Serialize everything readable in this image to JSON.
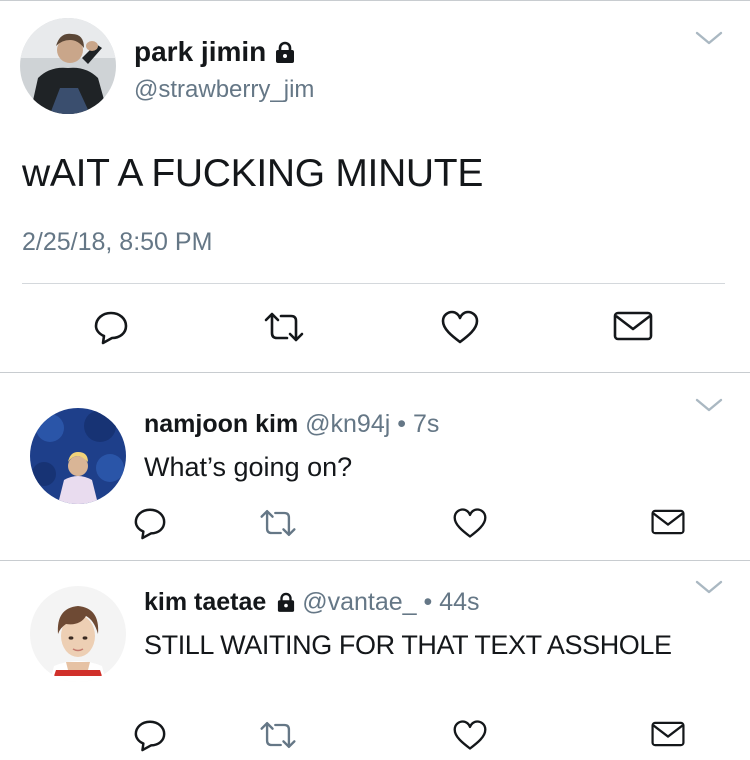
{
  "main_tweet": {
    "display_name": "park jimin",
    "handle": "@strawberry_jim",
    "text": "wAIT A FUCKING MINUTE",
    "timestamp": "2/25/18, 8:50 PM",
    "protected": true
  },
  "replies": [
    {
      "display_name": "namjoon kim",
      "handle": "@kn94j",
      "separator": "•",
      "time": "7s",
      "text": "What’s going on?",
      "protected": false
    },
    {
      "display_name": "kim taetae",
      "handle": "@vantae_",
      "separator": "•",
      "time": "44s",
      "text": "STILL WAITING FOR THAT TEXT ASSHOLE",
      "protected": true
    }
  ],
  "icons": {
    "reply": "reply-icon",
    "retweet": "retweet-icon",
    "like": "heart-icon",
    "message": "direct-message-icon",
    "lock": "lock-icon",
    "more": "chevron-down-icon"
  },
  "colors": {
    "text_primary": "#14171a",
    "text_secondary": "#657786",
    "divider": "#c8ccd0"
  }
}
